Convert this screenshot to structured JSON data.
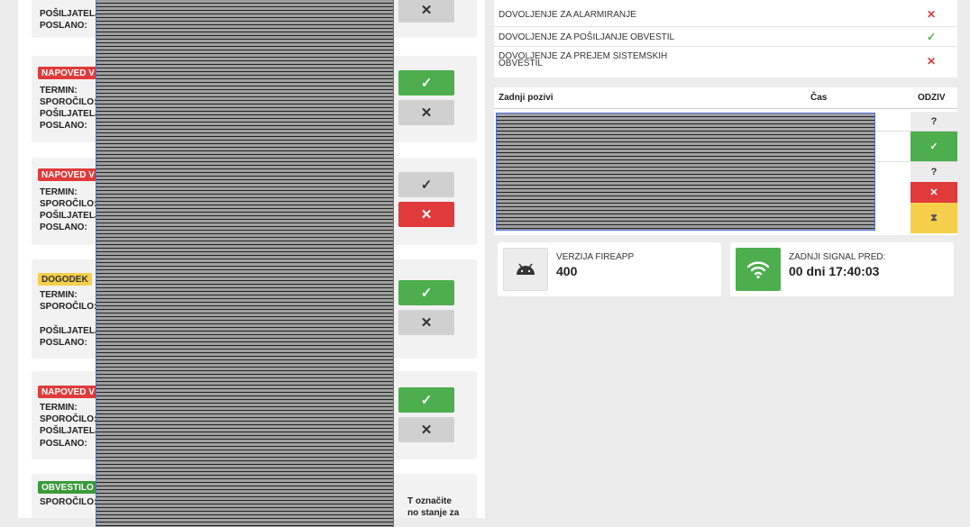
{
  "messages": {
    "field_labels": {
      "sender": "POŠILJATELJ",
      "sent": "POSLANO:",
      "term": "TERMIN:",
      "message": "SPOROČILO:"
    },
    "badges": {
      "napoved": "NAPOVED V",
      "dogodek": "DOGODEK",
      "obvestilo": "OBVESTILO"
    },
    "cut_text_1": "T označite",
    "cut_text_2": "no stanje za"
  },
  "permissions": [
    {
      "label": "DOVOLJENJE ZA ALARMIRANJE",
      "allowed": false
    },
    {
      "label": "DOVOLJENJE ZA POŠILJANJE OBVESTIL",
      "allowed": true
    },
    {
      "label": "DOVOLJENJE ZA PREJEM SISTEMSKIH",
      "label_line2": "OBVESTIL",
      "allowed": false
    }
  ],
  "calls": {
    "headers": {
      "last_calls": "Zadnji pozivi",
      "time": "Čas",
      "response": "ODZIV"
    },
    "responses": [
      "?",
      "✓",
      "?",
      "✕",
      "⧗"
    ]
  },
  "app_version": {
    "label": "VERZIJA FIREAPP",
    "value": "400",
    "icon": "android-icon"
  },
  "last_signal": {
    "label": "ZADNJI SIGNAL PRED:",
    "value": "00 dni 17:40:03",
    "icon": "wifi-icon"
  },
  "colors": {
    "accent_green": "#4cae4c",
    "alert_red": "#e03a3a",
    "pending_yellow": "#f5cf4a"
  }
}
